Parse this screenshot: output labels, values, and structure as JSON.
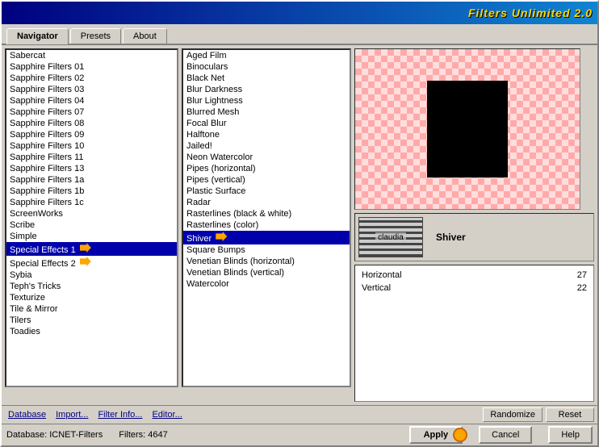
{
  "window": {
    "title": "Filters Unlimited 2.0"
  },
  "tabs": [
    {
      "label": "Navigator",
      "active": true
    },
    {
      "label": "Presets",
      "active": false
    },
    {
      "label": "About",
      "active": false
    }
  ],
  "left_list": {
    "items": [
      "Sabercat",
      "Sapphire Filters 01",
      "Sapphire Filters 02",
      "Sapphire Filters 03",
      "Sapphire Filters 04",
      "Sapphire Filters 07",
      "Sapphire Filters 08",
      "Sapphire Filters 09",
      "Sapphire Filters 10",
      "Sapphire Filters 11",
      "Sapphire Filters 13",
      "Sapphire Filters 1a",
      "Sapphire Filters 1b",
      "Sapphire Filters 1c",
      "ScreenWorks",
      "Scribe",
      "Simple",
      "Special Effects 1",
      "Special Effects 2",
      "Sybia",
      "Teph's Tricks",
      "Texturize",
      "Tile & Mirror",
      "Tilers",
      "Toadies"
    ],
    "selected_index": 17
  },
  "middle_list": {
    "items": [
      "Aged Film",
      "Binoculars",
      "Black Net",
      "Blur Darkness",
      "Blur Lightness",
      "Blurred Mesh",
      "Focal Blur",
      "Halftone",
      "Jailed!",
      "Neon Watercolor",
      "Pipes (horizontal)",
      "Pipes (vertical)",
      "Plastic Surface",
      "Radar",
      "Rasterlines (black & white)",
      "Rasterlines (color)",
      "Shiver",
      "Square Bumps",
      "Venetian Blinds (horizontal)",
      "Venetian Blinds (vertical)",
      "Watercolor"
    ],
    "selected_index": 16
  },
  "preview": {
    "filter_name": "Shiver"
  },
  "params": [
    {
      "label": "Horizontal",
      "value": "27"
    },
    {
      "label": "Vertical",
      "value": "22"
    }
  ],
  "toolbar": {
    "database_label": "Database",
    "import_label": "Import...",
    "filter_info_label": "Filter Info...",
    "editor_label": "Editor...",
    "randomize_label": "Randomize",
    "reset_label": "Reset"
  },
  "status_bar": {
    "database_label": "Database:",
    "database_value": "ICNET-Filters",
    "filters_label": "Filters:",
    "filters_value": "4647"
  },
  "action_buttons": {
    "apply": "Apply",
    "cancel": "Cancel",
    "help": "Help"
  },
  "thumbnail": {
    "label": "claudia"
  }
}
